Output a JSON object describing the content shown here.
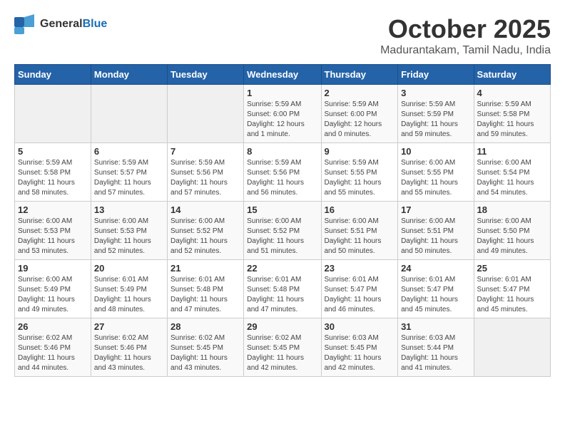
{
  "logo": {
    "general": "General",
    "blue": "Blue"
  },
  "title": "October 2025",
  "location": "Madurantakam, Tamil Nadu, India",
  "days_header": [
    "Sunday",
    "Monday",
    "Tuesday",
    "Wednesday",
    "Thursday",
    "Friday",
    "Saturday"
  ],
  "weeks": [
    [
      {
        "num": "",
        "detail": ""
      },
      {
        "num": "",
        "detail": ""
      },
      {
        "num": "",
        "detail": ""
      },
      {
        "num": "1",
        "detail": "Sunrise: 5:59 AM\nSunset: 6:00 PM\nDaylight: 12 hours\nand 1 minute."
      },
      {
        "num": "2",
        "detail": "Sunrise: 5:59 AM\nSunset: 6:00 PM\nDaylight: 12 hours\nand 0 minutes."
      },
      {
        "num": "3",
        "detail": "Sunrise: 5:59 AM\nSunset: 5:59 PM\nDaylight: 11 hours\nand 59 minutes."
      },
      {
        "num": "4",
        "detail": "Sunrise: 5:59 AM\nSunset: 5:58 PM\nDaylight: 11 hours\nand 59 minutes."
      }
    ],
    [
      {
        "num": "5",
        "detail": "Sunrise: 5:59 AM\nSunset: 5:58 PM\nDaylight: 11 hours\nand 58 minutes."
      },
      {
        "num": "6",
        "detail": "Sunrise: 5:59 AM\nSunset: 5:57 PM\nDaylight: 11 hours\nand 57 minutes."
      },
      {
        "num": "7",
        "detail": "Sunrise: 5:59 AM\nSunset: 5:56 PM\nDaylight: 11 hours\nand 57 minutes."
      },
      {
        "num": "8",
        "detail": "Sunrise: 5:59 AM\nSunset: 5:56 PM\nDaylight: 11 hours\nand 56 minutes."
      },
      {
        "num": "9",
        "detail": "Sunrise: 5:59 AM\nSunset: 5:55 PM\nDaylight: 11 hours\nand 55 minutes."
      },
      {
        "num": "10",
        "detail": "Sunrise: 6:00 AM\nSunset: 5:55 PM\nDaylight: 11 hours\nand 55 minutes."
      },
      {
        "num": "11",
        "detail": "Sunrise: 6:00 AM\nSunset: 5:54 PM\nDaylight: 11 hours\nand 54 minutes."
      }
    ],
    [
      {
        "num": "12",
        "detail": "Sunrise: 6:00 AM\nSunset: 5:53 PM\nDaylight: 11 hours\nand 53 minutes."
      },
      {
        "num": "13",
        "detail": "Sunrise: 6:00 AM\nSunset: 5:53 PM\nDaylight: 11 hours\nand 52 minutes."
      },
      {
        "num": "14",
        "detail": "Sunrise: 6:00 AM\nSunset: 5:52 PM\nDaylight: 11 hours\nand 52 minutes."
      },
      {
        "num": "15",
        "detail": "Sunrise: 6:00 AM\nSunset: 5:52 PM\nDaylight: 11 hours\nand 51 minutes."
      },
      {
        "num": "16",
        "detail": "Sunrise: 6:00 AM\nSunset: 5:51 PM\nDaylight: 11 hours\nand 50 minutes."
      },
      {
        "num": "17",
        "detail": "Sunrise: 6:00 AM\nSunset: 5:51 PM\nDaylight: 11 hours\nand 50 minutes."
      },
      {
        "num": "18",
        "detail": "Sunrise: 6:00 AM\nSunset: 5:50 PM\nDaylight: 11 hours\nand 49 minutes."
      }
    ],
    [
      {
        "num": "19",
        "detail": "Sunrise: 6:00 AM\nSunset: 5:49 PM\nDaylight: 11 hours\nand 49 minutes."
      },
      {
        "num": "20",
        "detail": "Sunrise: 6:01 AM\nSunset: 5:49 PM\nDaylight: 11 hours\nand 48 minutes."
      },
      {
        "num": "21",
        "detail": "Sunrise: 6:01 AM\nSunset: 5:48 PM\nDaylight: 11 hours\nand 47 minutes."
      },
      {
        "num": "22",
        "detail": "Sunrise: 6:01 AM\nSunset: 5:48 PM\nDaylight: 11 hours\nand 47 minutes."
      },
      {
        "num": "23",
        "detail": "Sunrise: 6:01 AM\nSunset: 5:47 PM\nDaylight: 11 hours\nand 46 minutes."
      },
      {
        "num": "24",
        "detail": "Sunrise: 6:01 AM\nSunset: 5:47 PM\nDaylight: 11 hours\nand 45 minutes."
      },
      {
        "num": "25",
        "detail": "Sunrise: 6:01 AM\nSunset: 5:47 PM\nDaylight: 11 hours\nand 45 minutes."
      }
    ],
    [
      {
        "num": "26",
        "detail": "Sunrise: 6:02 AM\nSunset: 5:46 PM\nDaylight: 11 hours\nand 44 minutes."
      },
      {
        "num": "27",
        "detail": "Sunrise: 6:02 AM\nSunset: 5:46 PM\nDaylight: 11 hours\nand 43 minutes."
      },
      {
        "num": "28",
        "detail": "Sunrise: 6:02 AM\nSunset: 5:45 PM\nDaylight: 11 hours\nand 43 minutes."
      },
      {
        "num": "29",
        "detail": "Sunrise: 6:02 AM\nSunset: 5:45 PM\nDaylight: 11 hours\nand 42 minutes."
      },
      {
        "num": "30",
        "detail": "Sunrise: 6:03 AM\nSunset: 5:45 PM\nDaylight: 11 hours\nand 42 minutes."
      },
      {
        "num": "31",
        "detail": "Sunrise: 6:03 AM\nSunset: 5:44 PM\nDaylight: 11 hours\nand 41 minutes."
      },
      {
        "num": "",
        "detail": ""
      }
    ]
  ]
}
